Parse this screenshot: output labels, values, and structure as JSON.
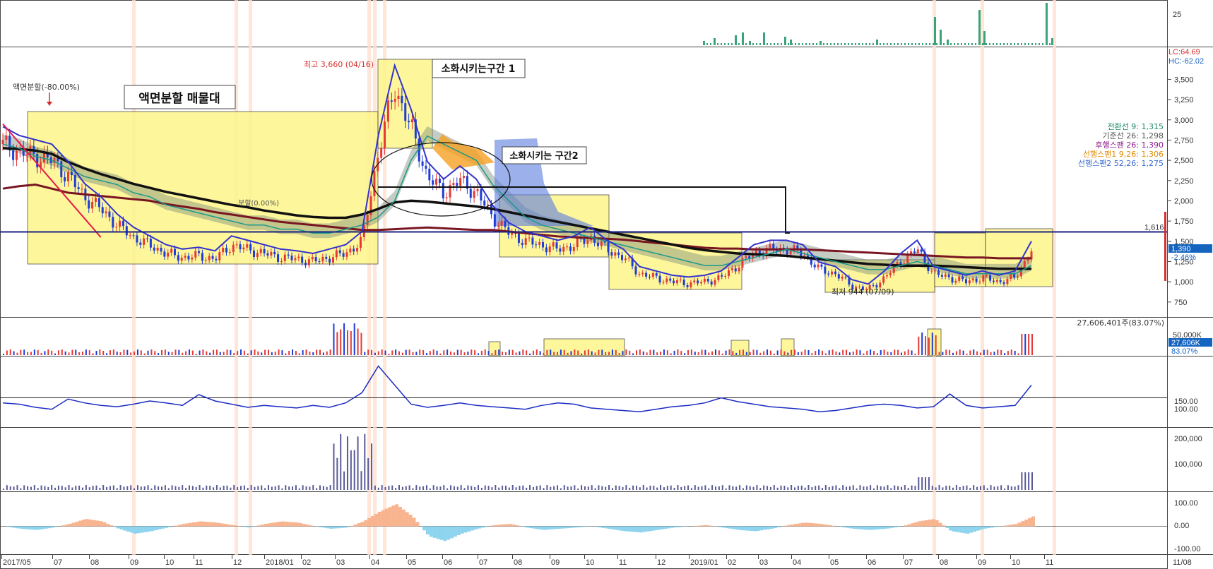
{
  "chart_data": {
    "type": "candlestick",
    "x_ticks": [
      "2017/05",
      "07",
      "08",
      "09",
      "10",
      "11",
      "12",
      "2018/01",
      "02",
      "03",
      "04",
      "05",
      "06",
      "07",
      "08",
      "09",
      "10",
      "11",
      "12",
      "2019/01",
      "02",
      "03",
      "04",
      "05",
      "06",
      "07",
      "08",
      "09",
      "10",
      "11",
      "11/08"
    ],
    "panels": {
      "top_volume": {
        "ticks": [
          "25"
        ]
      },
      "price": {
        "y_ticks": [
          "3,500",
          "3,250",
          "3,000",
          "2,750",
          "2,500",
          "2,250",
          "2,000",
          "1,750",
          "1,500",
          "1,250",
          "1,000",
          "750"
        ],
        "ylim": [
          600,
          3800
        ],
        "close_series": [
          2700,
          2600,
          2550,
          2500,
          2300,
          2050,
          1900,
          1700,
          1550,
          1450,
          1350,
          1300,
          1320,
          1280,
          1450,
          1400,
          1350,
          1300,
          1280,
          1250,
          1300,
          1350,
          1500,
          2600,
          3400,
          2900,
          2300,
          2100,
          2250,
          2100,
          1800,
          1600,
          1500,
          1450,
          1400,
          1450,
          1550,
          1400,
          1300,
          1100,
          1050,
          1000,
          980,
          1000,
          1050,
          1200,
          1350,
          1400,
          1400,
          1350,
          1150,
          1100,
          950,
          900,
          1050,
          1250,
          1400,
          1100,
          1050,
          1000,
          1050,
          1000,
          1050,
          1390
        ],
        "ma_long_series": [
          2150,
          2180,
          2200,
          2150,
          2100,
          2080,
          2060,
          2040,
          2020,
          2000,
          1960,
          1930,
          1900,
          1860,
          1830,
          1800,
          1770,
          1740,
          1720,
          1700,
          1680,
          1660,
          1640,
          1640,
          1650,
          1660,
          1670,
          1660,
          1650,
          1640,
          1640,
          1620,
          1600,
          1580,
          1560,
          1550,
          1540,
          1530,
          1520,
          1500,
          1480,
          1460,
          1440,
          1420,
          1410,
          1410,
          1400,
          1400,
          1400,
          1400,
          1390,
          1380,
          1370,
          1360,
          1350,
          1340,
          1330,
          1320,
          1310,
          1300,
          1300,
          1290,
          1290,
          1290
        ],
        "ma_mid_series": [
          2650,
          2640,
          2620,
          2580,
          2480,
          2400,
          2330,
          2270,
          2210,
          2160,
          2110,
          2070,
          2030,
          1990,
          1950,
          1920,
          1880,
          1850,
          1820,
          1800,
          1790,
          1790,
          1830,
          1900,
          1980,
          2000,
          1990,
          1970,
          1950,
          1930,
          1900,
          1860,
          1820,
          1780,
          1740,
          1700,
          1660,
          1620,
          1580,
          1540,
          1500,
          1460,
          1420,
          1390,
          1370,
          1350,
          1340,
          1330,
          1320,
          1300,
          1280,
          1260,
          1240,
          1220,
          1210,
          1200,
          1200,
          1200,
          1190,
          1180,
          1170,
          1160,
          1160,
          1160
        ],
        "span_band_series": [
          2700,
          2650,
          2550,
          2500,
          2400,
          2300,
          2250,
          2200,
          2100,
          2050,
          1950,
          1900,
          1850,
          1800,
          1750,
          1700,
          1700,
          1650,
          1650,
          1600,
          1600,
          1650,
          1700,
          1800,
          2000,
          2500,
          2800,
          2700,
          2600,
          2500,
          2200,
          2000,
          1800,
          1700,
          1650,
          1600,
          1550,
          1500,
          1450,
          1400,
          1350,
          1300,
          1250,
          1200,
          1200,
          1250,
          1300,
          1350,
          1400,
          1350,
          1300,
          1250,
          1200,
          1150,
          1150,
          1200,
          1250,
          1200,
          1150,
          1100,
          1100,
          1100,
          1100,
          1200
        ],
        "horizontal_line": {
          "value": 1616,
          "label": "1,616"
        },
        "annotations": {
          "split_label": "액면분할(-80.00%)",
          "split_zone": "액면분할 매물대",
          "digest_zone_1": "소화시키는구간 1",
          "digest_zone_2": "소화시키는 구간2",
          "high": "최고 3,660 (04/16)",
          "low": "최저 944 (07/09)",
          "mid_label": "분할(0.00%)"
        },
        "legend": [
          {
            "text": "전환선 9: 1,315",
            "color": "#1b8a6b"
          },
          {
            "text": "기준선 26: 1,298",
            "color": "#555555"
          },
          {
            "text": "후행스팬 26: 1,390",
            "color": "#8a1b8a"
          },
          {
            "text": "선행스팬1 9,26: 1,306",
            "color": "#e08a00"
          },
          {
            "text": "선행스팬2 52,26: 1,275",
            "color": "#3a6acd"
          }
        ],
        "top_right": {
          "lc": "LC:64.69",
          "hc": "HC:-62.02"
        },
        "price_tag": {
          "value": "1,390",
          "change": "-2.46%"
        }
      },
      "volume": {
        "y_ticks": [
          "50,000K"
        ],
        "header": "27,606,401주(83.07%)",
        "tag": {
          "value": "27,606K",
          "pct": "83.07%"
        }
      },
      "indicator_1": {
        "y_ticks": [
          "150.00",
          "100.00"
        ],
        "level": 120,
        "series": [
          112,
          110,
          105,
          102,
          118,
          112,
          108,
          106,
          110,
          115,
          112,
          108,
          125,
          115,
          110,
          105,
          108,
          106,
          104,
          108,
          105,
          112,
          128,
          170,
          140,
          110,
          105,
          108,
          112,
          108,
          106,
          104,
          102,
          108,
          112,
          110,
          104,
          102,
          100,
          98,
          102,
          106,
          108,
          112,
          120,
          114,
          110,
          106,
          104,
          102,
          98,
          100,
          104,
          108,
          110,
          108,
          104,
          106,
          126,
          108,
          104,
          106,
          108,
          140
        ]
      },
      "indicator_2": {
        "y_ticks": [
          "200,000",
          "100,000"
        ]
      },
      "oscillator": {
        "y_ticks": [
          "100.00",
          "0.00",
          "-100.00"
        ],
        "series": [
          0,
          -10,
          -15,
          -5,
          10,
          30,
          20,
          -10,
          -30,
          -20,
          -5,
          10,
          20,
          15,
          5,
          -5,
          10,
          20,
          15,
          0,
          -10,
          -5,
          20,
          60,
          90,
          40,
          -40,
          -60,
          -30,
          -10,
          5,
          10,
          -5,
          -15,
          -10,
          -5,
          0,
          -10,
          -20,
          -25,
          -15,
          -5,
          0,
          5,
          -5,
          -15,
          -20,
          -10,
          5,
          15,
          10,
          0,
          -10,
          -15,
          -10,
          0,
          20,
          30,
          -20,
          -30,
          -10,
          0,
          10,
          40
        ]
      }
    }
  }
}
